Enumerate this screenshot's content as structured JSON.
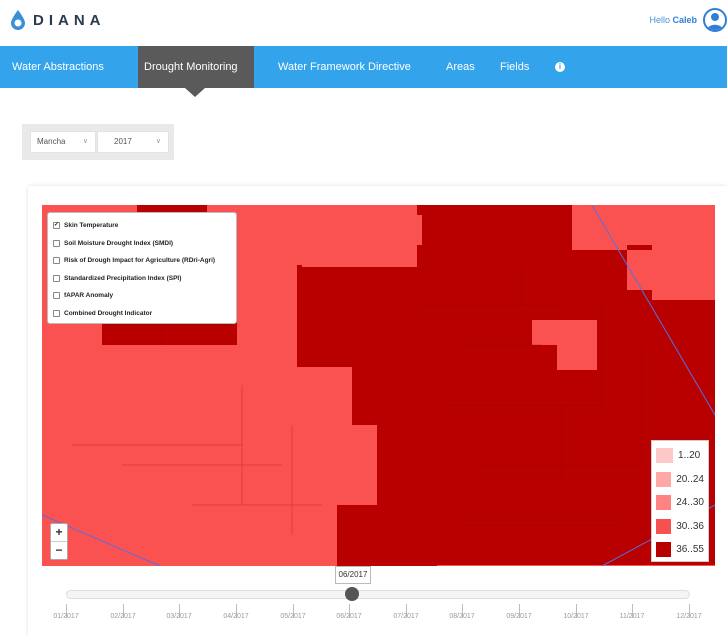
{
  "app": {
    "logo_text": "DIANA"
  },
  "header": {
    "greeting": "Hello",
    "username": "Caleb"
  },
  "nav": {
    "items": [
      {
        "label": "Water Abstractions"
      },
      {
        "label": "Drought Monitoring",
        "active": true
      },
      {
        "label": "Water Framework Directive"
      },
      {
        "label": "Areas"
      },
      {
        "label": "Fields"
      }
    ],
    "info_icon": "info-icon"
  },
  "filters": {
    "region": "Mancha",
    "year": "2017"
  },
  "layers": [
    {
      "label": "Skin Temperature",
      "checked": true
    },
    {
      "label": "Soil Moisture Drought Index (SMDI)",
      "checked": false
    },
    {
      "label": "Risk of Drough Impact for Agriculture (RDri-Agri)",
      "checked": false
    },
    {
      "label": "Standardized Precipitation Index (SPI)",
      "checked": false
    },
    {
      "label": "fAPAR Anomaly",
      "checked": false
    },
    {
      "label": "Combined Drought Indicator",
      "checked": false
    }
  ],
  "zoom": {
    "in": "+",
    "out": "−"
  },
  "legend": [
    {
      "label": "1..20",
      "color": "#ffc8c8"
    },
    {
      "label": "20..24",
      "color": "#ffa8a8"
    },
    {
      "label": "24..30",
      "color": "#ff8383"
    },
    {
      "label": "30..36",
      "color": "#f84f4f"
    },
    {
      "label": "36..55",
      "color": "#b80000"
    }
  ],
  "map_colors": {
    "low": "#fa5151",
    "high": "#b80000"
  },
  "timeline": {
    "selected": "06/2017",
    "months": [
      "01/2017",
      "02/2017",
      "03/2017",
      "04/2017",
      "05/2017",
      "06/2017",
      "07/2017",
      "08/2017",
      "09/2017",
      "10/2017",
      "11/2017",
      "12/2017"
    ]
  }
}
